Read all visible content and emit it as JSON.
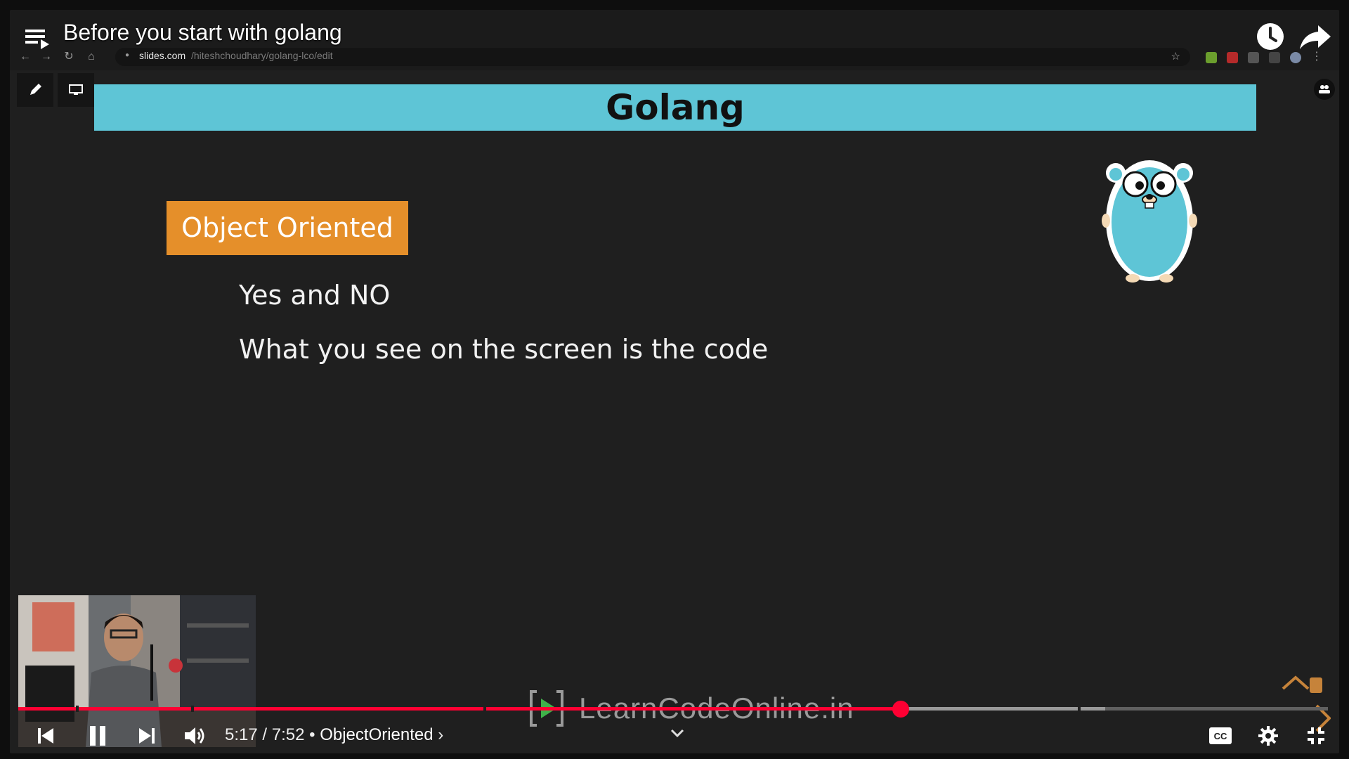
{
  "youtube": {
    "video_title": "Before you start with golang",
    "time_current": "5:17",
    "time_total": "7:52",
    "chapter": "ObjectOriented",
    "progress_fraction": 0.674,
    "buffer_fraction": 0.83
  },
  "browser": {
    "url_domain": "slides.com",
    "url_path": "/hiteshchoudhary/golang-lco/edit"
  },
  "slide": {
    "title": "Golang",
    "tag": "Object Oriented",
    "lines": [
      "Yes and NO",
      "What you see on the screen is the code"
    ]
  },
  "watermark": {
    "text": "LearnCodeOnline.in"
  },
  "colors": {
    "banner": "#5ec5d6",
    "tag": "#e58f2a",
    "progress": "#ff0033"
  }
}
